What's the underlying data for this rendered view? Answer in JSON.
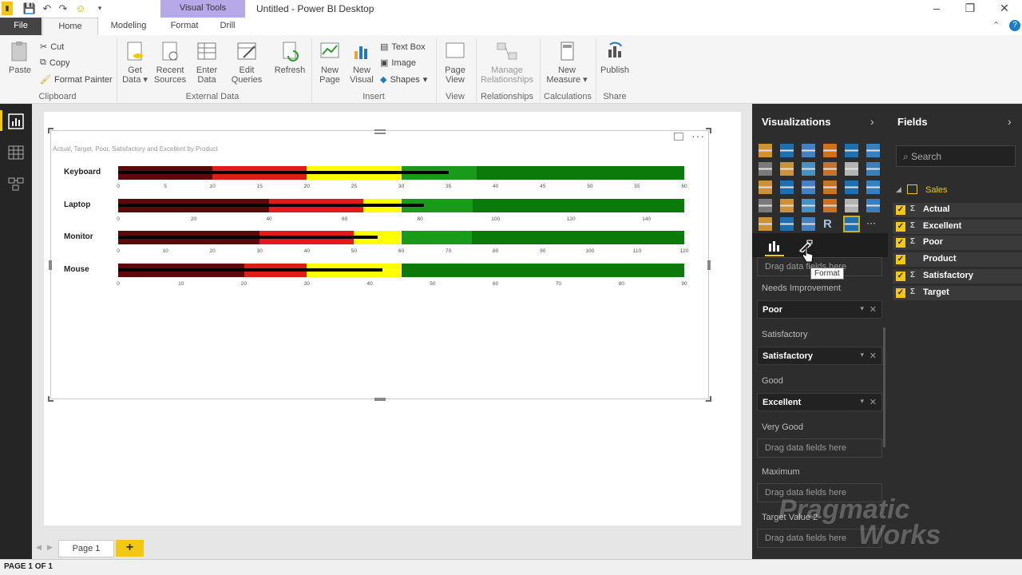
{
  "window": {
    "title": "Untitled - Power BI Desktop",
    "context_tab": "Visual Tools"
  },
  "tabs": {
    "file": "File",
    "home": "Home",
    "modeling": "Modeling",
    "format": "Format",
    "drill": "Drill"
  },
  "ribbon": {
    "clipboard": {
      "paste": "Paste",
      "cut": "Cut",
      "copy": "Copy",
      "format_painter": "Format Painter",
      "group": "Clipboard"
    },
    "external": {
      "get_data": "Get Data",
      "recent_sources": "Recent Sources",
      "enter_data": "Enter Data",
      "edit_queries": "Edit Queries",
      "refresh": "Refresh",
      "group": "External Data"
    },
    "insert": {
      "new_page": "New Page",
      "new_visual": "New Visual",
      "text_box": "Text Box",
      "image": "Image",
      "shapes": "Shapes",
      "group": "Insert"
    },
    "view": {
      "page_view": "Page View",
      "group": "View"
    },
    "relationships": {
      "manage": "Manage Relationships",
      "group": "Relationships"
    },
    "calculations": {
      "new_measure": "New Measure",
      "group": "Calculations"
    },
    "share": {
      "publish": "Publish",
      "group": "Share"
    }
  },
  "visual": {
    "title": "Actual, Target, Poor, Satisfactory and Excellent by Product",
    "colors": {
      "poor_dark": "#5a0a0a",
      "poor": "#e01b1b",
      "satisfactory": "#ffff00",
      "good": "#1a9a1a",
      "excellent": "#0b7a0b",
      "actual": "#000000"
    },
    "rows": [
      {
        "label": "Keyboard",
        "max": 60,
        "segments": [
          10,
          20,
          30,
          38,
          60
        ],
        "actual": 35,
        "ticks": [
          "0",
          "5",
          "10",
          "15",
          "20",
          "25",
          "30",
          "35",
          "40",
          "45",
          "50",
          "55",
          "60"
        ]
      },
      {
        "label": "Laptop",
        "max": 150,
        "segments": [
          40,
          65,
          75,
          94,
          150
        ],
        "actual": 81,
        "ticks": [
          "0",
          "20",
          "40",
          "60",
          "80",
          "100",
          "120",
          "140"
        ]
      },
      {
        "label": "Monitor",
        "max": 120,
        "segments": [
          30,
          50,
          60,
          75,
          120
        ],
        "actual": 55,
        "ticks": [
          "0",
          "10",
          "20",
          "30",
          "40",
          "50",
          "60",
          "70",
          "80",
          "90",
          "100",
          "110",
          "120"
        ]
      },
      {
        "label": "Mouse",
        "max": 90,
        "segments": [
          20,
          30,
          45,
          45,
          90
        ],
        "actual": 42,
        "ticks": [
          "0",
          "10",
          "20",
          "30",
          "40",
          "50",
          "60",
          "70",
          "80",
          "90"
        ]
      }
    ]
  },
  "pages": {
    "page1": "Page 1",
    "add": "+",
    "status": "PAGE 1 OF 1"
  },
  "viz_pane": {
    "title": "Visualizations",
    "tooltip": "Format",
    "wells": [
      {
        "header": "",
        "value": "Drag data fields here",
        "type": "drag"
      },
      {
        "header": "Needs Improvement",
        "value": "Poor",
        "type": "field"
      },
      {
        "header": "Satisfactory",
        "value": "Satisfactory",
        "type": "field"
      },
      {
        "header": "Good",
        "value": "Excellent",
        "type": "field"
      },
      {
        "header": "Very Good",
        "value": "Drag data fields here",
        "type": "drag"
      },
      {
        "header": "Maximum",
        "value": "Drag data fields here",
        "type": "drag"
      },
      {
        "header": "Target Value 2",
        "value": "Drag data fields here",
        "type": "drag"
      }
    ]
  },
  "fields_pane": {
    "title": "Fields",
    "search_placeholder": "Search",
    "table": "Sales",
    "fields": [
      {
        "name": "Actual",
        "sigma": "Σ"
      },
      {
        "name": "Excellent",
        "sigma": "Σ"
      },
      {
        "name": "Poor",
        "sigma": "Σ"
      },
      {
        "name": "Product",
        "sigma": ""
      },
      {
        "name": "Satisfactory",
        "sigma": "Σ"
      },
      {
        "name": "Target",
        "sigma": "Σ"
      }
    ]
  },
  "watermark": {
    "line1": "Pragmatic",
    "line2": "Works"
  }
}
